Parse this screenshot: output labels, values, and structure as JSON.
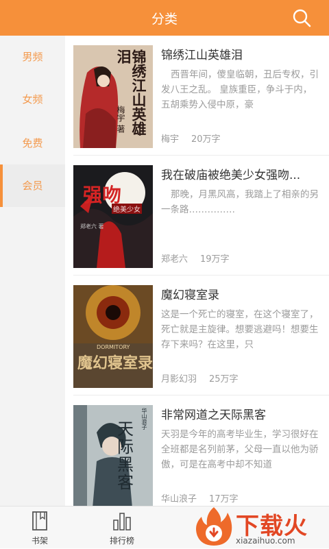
{
  "header": {
    "title": "分类",
    "search_icon": "search-icon"
  },
  "sidebar": {
    "items": [
      {
        "label": "男频"
      },
      {
        "label": "女频"
      },
      {
        "label": "免费"
      },
      {
        "label": "会员",
        "active": true
      }
    ]
  },
  "books": [
    {
      "title": "锦绣江山英雄泪",
      "desc": "西晋年间，傻皇临朝，丑后专权，引发八王之乱。 皇族重臣，争斗于内，五胡乘势入侵中原，豪",
      "author": "梅宇",
      "words": "20万字",
      "cover_text": [
        "锦绣江山英雄泪",
        "梅宇 著"
      ]
    },
    {
      "title": "我在破庙被绝美少女强吻...",
      "desc": "那晚，月黑风高，我踏上了相亲的另一条路……………",
      "author": "郑老六",
      "words": "19万字",
      "cover_text": [
        "强吻",
        "绝美少女",
        "郑老六 著"
      ]
    },
    {
      "title": "魔幻寝室录",
      "desc": "这是一个死亡的寝室，在这个寝室了，死亡就是主旋律。想要逃避吗！想要生存下来吗？在这里，只",
      "author": "月影幻羽",
      "words": "25万字",
      "cover_text": [
        "魔幻寝室录",
        "DORMITORY"
      ]
    },
    {
      "title": "非常网道之天际黑客",
      "desc": "天羽是今年的高考毕业生，学习很好在全班都是名列前茅，父母一直以他为骄傲，可是在高考中却不知道",
      "author": "华山浪子",
      "words": "17万字",
      "cover_text": [
        "天际黑客",
        "华山浪子"
      ]
    }
  ],
  "tabbar": {
    "tabs": [
      {
        "label": "书架",
        "icon": "bookshelf-icon"
      },
      {
        "label": "排行榜",
        "icon": "ranking-icon"
      }
    ]
  },
  "watermark": {
    "text": "下载火",
    "sub": "xiazaihuo.com"
  },
  "colors": {
    "accent": "#f6903a",
    "sidebar_text": "#f39a4e",
    "watermark": "#e24724"
  }
}
